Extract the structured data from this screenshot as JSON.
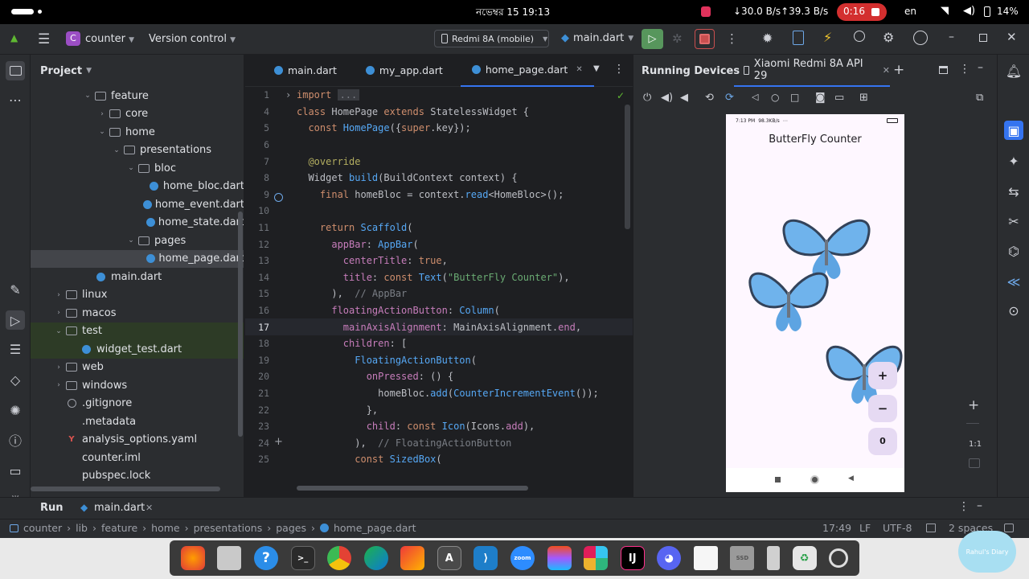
{
  "status_bar": {
    "date_time": "নভেম্বর 15  19:13",
    "network_speed": "↓30.0 B/s↑39.3 B/s",
    "record_time": "0:16",
    "language": "en",
    "battery": "14%"
  },
  "title_bar": {
    "project_badge": "C",
    "project_name": "counter",
    "vcs_label": "Version control",
    "device_selector": "Redmi 8A (mobile)",
    "run_config": "main.dart"
  },
  "project_panel": {
    "title": "Project",
    "tree": [
      {
        "label": "feature",
        "type": "folder",
        "depth": 3,
        "expanded": true
      },
      {
        "label": "core",
        "type": "folder",
        "depth": 4,
        "expanded": false
      },
      {
        "label": "home",
        "type": "folder",
        "depth": 4,
        "expanded": true
      },
      {
        "label": "presentations",
        "type": "folder",
        "depth": 5,
        "expanded": true
      },
      {
        "label": "bloc",
        "type": "folder",
        "depth": 6,
        "expanded": true
      },
      {
        "label": "home_bloc.dart",
        "type": "dart",
        "depth": 7
      },
      {
        "label": "home_event.dart",
        "type": "dart",
        "depth": 7
      },
      {
        "label": "home_state.dart",
        "type": "dart",
        "depth": 7
      },
      {
        "label": "pages",
        "type": "folder",
        "depth": 6,
        "expanded": true
      },
      {
        "label": "home_page.dart",
        "type": "dart",
        "depth": 7,
        "selected": true
      },
      {
        "label": "main.dart",
        "type": "dart",
        "depth": 3
      },
      {
        "label": "linux",
        "type": "folder",
        "depth": 1,
        "expanded": false
      },
      {
        "label": "macos",
        "type": "folder",
        "depth": 1,
        "expanded": false
      },
      {
        "label": "test",
        "type": "folder",
        "depth": 1,
        "expanded": true,
        "highlight": true
      },
      {
        "label": "widget_test.dart",
        "type": "dart",
        "depth": 2,
        "highlight": true
      },
      {
        "label": "web",
        "type": "folder",
        "depth": 1,
        "expanded": false
      },
      {
        "label": "windows",
        "type": "folder",
        "depth": 1,
        "expanded": false
      },
      {
        "label": ".gitignore",
        "type": "ignore",
        "depth": 1
      },
      {
        "label": ".metadata",
        "type": "file",
        "depth": 1
      },
      {
        "label": "analysis_options.yaml",
        "type": "yaml",
        "depth": 1
      },
      {
        "label": "counter.iml",
        "type": "file",
        "depth": 1
      },
      {
        "label": "pubspec.lock",
        "type": "file",
        "depth": 1
      }
    ]
  },
  "editor": {
    "tabs": [
      {
        "label": "main.dart",
        "active": false
      },
      {
        "label": "my_app.dart",
        "active": false
      },
      {
        "label": "home_page.dart",
        "active": true
      }
    ],
    "current_line": "17",
    "lines": [
      {
        "n": "1",
        "tokens": [
          [
            "kw",
            "import "
          ],
          [
            "cm",
            "..."
          ]
        ]
      },
      {
        "n": "4",
        "tokens": [
          [
            "kw",
            "class "
          ],
          [
            "cls",
            "HomePage "
          ],
          [
            "kw",
            "extends "
          ],
          [
            "cls",
            "StatelessWidget {"
          ]
        ]
      },
      {
        "n": "5",
        "tokens": [
          [
            "kw",
            "  const "
          ],
          [
            "fn",
            "HomePage"
          ],
          [
            "pu",
            "({"
          ],
          [
            "kw",
            "super"
          ],
          [
            "pu",
            ".key});"
          ]
        ]
      },
      {
        "n": "6",
        "tokens": []
      },
      {
        "n": "7",
        "tokens": [
          [
            "an",
            "  @override"
          ]
        ]
      },
      {
        "n": "8",
        "tokens": [
          [
            "cls",
            "  Widget "
          ],
          [
            "fn",
            "build"
          ],
          [
            "pu",
            "(BuildContext context) {"
          ]
        ]
      },
      {
        "n": "9",
        "tokens": [
          [
            "kw",
            "    final "
          ],
          [
            "pu",
            "homeBloc = context."
          ],
          [
            "fn",
            "read"
          ],
          [
            "pu",
            "<HomeBloc>();"
          ]
        ]
      },
      {
        "n": "10",
        "tokens": []
      },
      {
        "n": "11",
        "tokens": [
          [
            "kw",
            "    return "
          ],
          [
            "fn",
            "Scaffold"
          ],
          [
            "pu",
            "("
          ]
        ]
      },
      {
        "n": "12",
        "tokens": [
          [
            "pr",
            "      appBar"
          ],
          [
            "pu",
            ": "
          ],
          [
            "fn",
            "AppBar"
          ],
          [
            "pu",
            "("
          ]
        ]
      },
      {
        "n": "13",
        "tokens": [
          [
            "pr",
            "        centerTitle"
          ],
          [
            "pu",
            ": "
          ],
          [
            "kw",
            "true"
          ],
          [
            "pu",
            ","
          ]
        ]
      },
      {
        "n": "14",
        "tokens": [
          [
            "pr",
            "        title"
          ],
          [
            "pu",
            ": "
          ],
          [
            "kw",
            "const "
          ],
          [
            "fn",
            "Text"
          ],
          [
            "pu",
            "("
          ],
          [
            "str",
            "\"ButterFly Counter\""
          ],
          [
            "pu",
            "),"
          ]
        ]
      },
      {
        "n": "15",
        "tokens": [
          [
            "pu",
            "      ),  "
          ],
          [
            "cm",
            "// AppBar"
          ]
        ]
      },
      {
        "n": "16",
        "tokens": [
          [
            "pr",
            "      floatingActionButton"
          ],
          [
            "pu",
            ": "
          ],
          [
            "fn",
            "Column"
          ],
          [
            "pu",
            "("
          ]
        ]
      },
      {
        "n": "17",
        "tokens": [
          [
            "pr",
            "        mainAxisAlignment"
          ],
          [
            "pu",
            ": MainAxisAlignment."
          ],
          [
            "pr",
            "end"
          ],
          [
            "pu",
            ","
          ]
        ]
      },
      {
        "n": "18",
        "tokens": [
          [
            "pr",
            "        children"
          ],
          [
            "pu",
            ": ["
          ]
        ]
      },
      {
        "n": "19",
        "tokens": [
          [
            "fn",
            "          FloatingActionButton"
          ],
          [
            "pu",
            "("
          ]
        ]
      },
      {
        "n": "20",
        "tokens": [
          [
            "pr",
            "            onPressed"
          ],
          [
            "pu",
            ": () {"
          ]
        ]
      },
      {
        "n": "21",
        "tokens": [
          [
            "pu",
            "              homeBloc."
          ],
          [
            "fn",
            "add"
          ],
          [
            "pu",
            "("
          ],
          [
            "fn",
            "CounterIncrementEvent"
          ],
          [
            "pu",
            "());"
          ]
        ]
      },
      {
        "n": "22",
        "tokens": [
          [
            "pu",
            "            },"
          ]
        ]
      },
      {
        "n": "23",
        "tokens": [
          [
            "pr",
            "            child"
          ],
          [
            "pu",
            ": "
          ],
          [
            "kw",
            "const "
          ],
          [
            "fn",
            "Icon"
          ],
          [
            "pu",
            "(Icons."
          ],
          [
            "pr",
            "add"
          ],
          [
            "pu",
            "),"
          ]
        ]
      },
      {
        "n": "24",
        "tokens": [
          [
            "pu",
            "          ),  "
          ],
          [
            "cm",
            "// FloatingActionButton"
          ]
        ]
      },
      {
        "n": "25",
        "tokens": [
          [
            "kw",
            "          const "
          ],
          [
            "fn",
            "SizedBox"
          ],
          [
            "pu",
            "("
          ]
        ]
      }
    ]
  },
  "running_devices": {
    "title": "Running Devices",
    "device_tab": "Xiaomi Redmi 8A API 29",
    "zoom_label": "1:1",
    "phone": {
      "status_time": "7:13 PM",
      "status_speed": "98.3KB/s",
      "app_title": "ButterFly Counter",
      "counter_value": "0",
      "fab_plus": "+",
      "fab_minus": "−"
    }
  },
  "bottom_bar": {
    "run_label": "Run",
    "run_tab": "main.dart"
  },
  "breadcrumbs": {
    "items": [
      "counter",
      "lib",
      "feature",
      "home",
      "presentations",
      "pages",
      "home_page.dart"
    ],
    "position": "17:49",
    "line_sep": "LF",
    "encoding": "UTF-8",
    "indent": "2 spaces"
  },
  "taskbar": {
    "apps": [
      "firefox",
      "files",
      "help",
      "terminal",
      "chrome",
      "edge",
      "vivaldi",
      "android-studio",
      "vscode",
      "zoom",
      "figma",
      "slack",
      "intellij",
      "discord",
      "notes",
      "ssd",
      "usb",
      "trash",
      "settings"
    ],
    "zoom_label": "zoom",
    "ssd_label": "SSD"
  },
  "watermark": "Rahul's Diary"
}
